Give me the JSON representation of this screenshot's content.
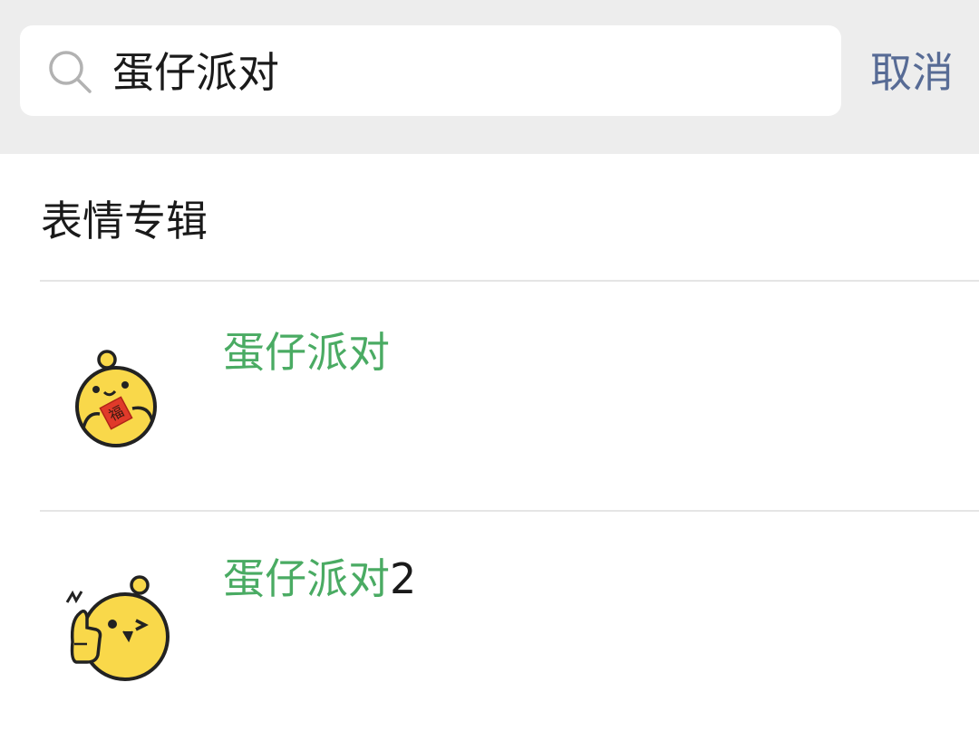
{
  "search": {
    "query": "蛋仔派对",
    "cancel_label": "取消"
  },
  "section": {
    "title": "表情专辑"
  },
  "results": [
    {
      "highlight": "蛋仔派对",
      "suffix": "",
      "icon": "egg-party-fu-sticker-icon"
    },
    {
      "highlight": "蛋仔派对",
      "suffix": "2",
      "icon": "egg-party-thumbs-up-sticker-icon"
    }
  ],
  "colors": {
    "highlight": "#4aab63",
    "cancel": "#576b95",
    "search_bar_bg": "#ededed",
    "sticker_yellow": "#f9d84a"
  }
}
